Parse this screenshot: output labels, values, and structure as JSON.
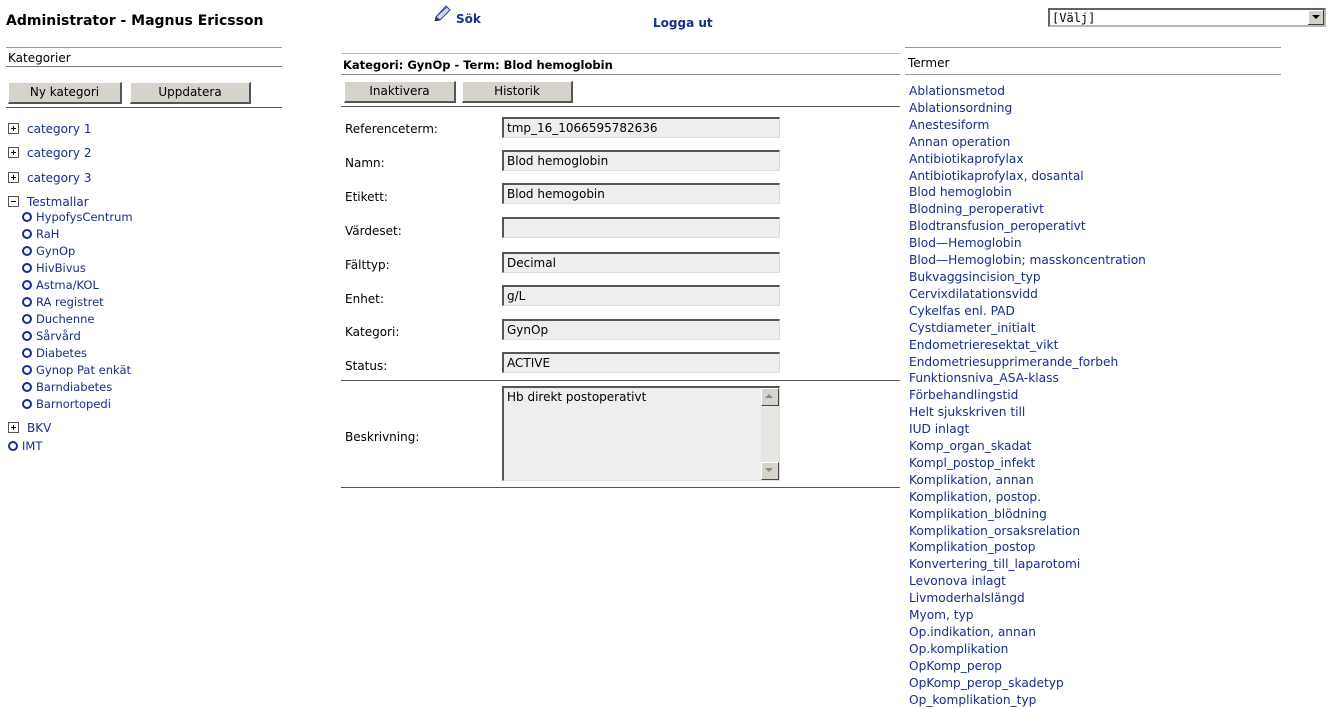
{
  "header": {
    "title": "Administrator - Magnus Ericsson",
    "search_label": "Sök",
    "logout_label": "Logga ut",
    "select_value": "[Välj]"
  },
  "categories": {
    "header": "Kategorier",
    "new_button": "Ny kategori",
    "update_button": "Uppdatera",
    "tree": [
      {
        "label": "category 1",
        "type": "collapsed"
      },
      {
        "label": "category 2",
        "type": "collapsed"
      },
      {
        "label": "category 3",
        "type": "collapsed"
      },
      {
        "label": "Testmallar",
        "type": "expanded",
        "children": [
          "HypofysCentrum",
          "RaH",
          "GynOp",
          "HivBivus",
          "Astma/KOL",
          "RA registret",
          "Duchenne",
          "Sårvård",
          "Diabetes",
          "Gynop Pat enkät",
          "Barndiabetes",
          "Barnortopedi"
        ]
      },
      {
        "label": "BKV",
        "type": "collapsed"
      },
      {
        "label": "IMT",
        "type": "leaf"
      }
    ]
  },
  "detail": {
    "header": "Kategori: GynOp - Term: Blod hemoglobin",
    "inactivate_button": "Inaktivera",
    "history_button": "Historik",
    "fields": [
      {
        "label": "Referenceterm:",
        "value": "tmp_16_1066595782636"
      },
      {
        "label": "Namn:",
        "value": "Blod hemoglobin"
      },
      {
        "label": "Etikett:",
        "value": "Blod hemogobin"
      },
      {
        "label": "Värdeset:",
        "value": ""
      },
      {
        "label": "Fälttyp:",
        "value": "Decimal"
      },
      {
        "label": "Enhet:",
        "value": "g/L"
      },
      {
        "label": "Kategori:",
        "value": "GynOp"
      },
      {
        "label": "Status:",
        "value": "ACTIVE"
      }
    ],
    "description_label": "Beskrivning:",
    "description_value": "Hb direkt postoperativt"
  },
  "terms": {
    "header": "Termer",
    "items": [
      "Ablationsmetod",
      "Ablationsordning",
      "Anestesiform",
      "Annan operation",
      "Antibiotikaprofylax",
      "Antibiotikaprofylax, dosantal",
      "Blod hemoglobin",
      "Blodning_peroperativt",
      "Blodtransfusion_peroperativt",
      "Blod—Hemoglobin",
      "Blod—Hemoglobin; masskoncentration",
      "Bukvaggsincision_typ",
      "Cervixdilatationsvidd",
      "Cykelfas enl. PAD",
      "Cystdiameter_initialt",
      "Endometrieresektat_vikt",
      "Endometriesupprimerande_forbeh",
      "Funktionsniva_ASA-klass",
      "Förbehandlingstid",
      "Helt sjukskriven till",
      "IUD inlagt",
      "Komp_organ_skadat",
      "Kompl_postop_infekt",
      "Komplikation, annan",
      "Komplikation, postop.",
      "Komplikation_blödning",
      "Komplikation_orsaksrelation",
      "Komplikation_postop",
      "Konvertering_till_laparotomi",
      "Levonova inlagt",
      "Livmoderhalslängd",
      "Myom, typ",
      "Op.indikation, annan",
      "Op.komplikation",
      "OpKomp_perop",
      "OpKomp_perop_skadetyp",
      "Op_komplikation_typ"
    ]
  }
}
